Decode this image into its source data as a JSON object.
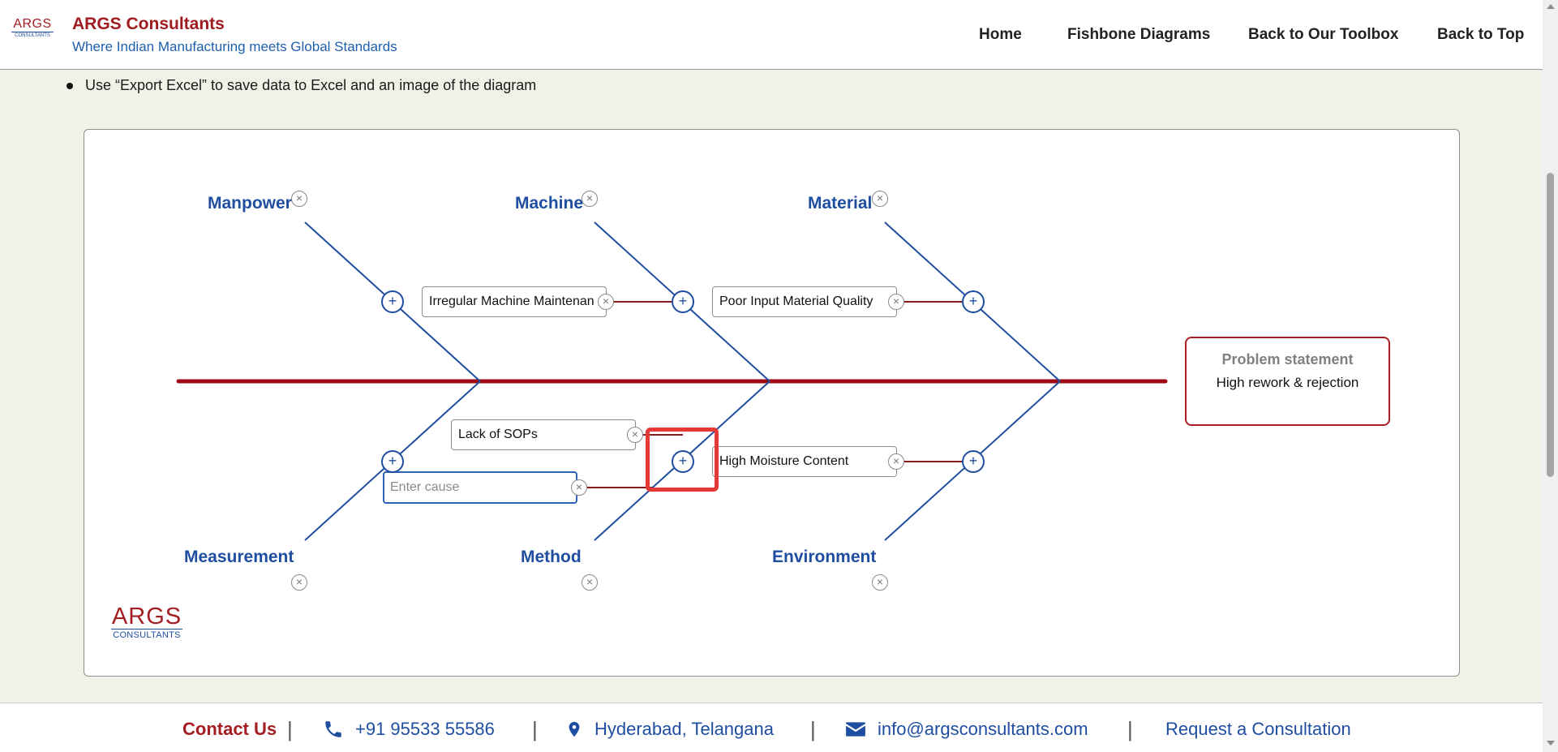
{
  "header": {
    "logo_text": "ARGS",
    "logo_sub": "CONSULTANTS",
    "title": "ARGS Consultants",
    "subtitle": "Where Indian Manufacturing meets Global Standards",
    "nav": [
      "Home",
      "Fishbone Diagrams",
      "Back to Our Toolbox",
      "Back to Top"
    ]
  },
  "instructions": {
    "bullet": "Use “Export Excel” to save data to Excel and an image of the diagram"
  },
  "diagram": {
    "categories": {
      "manpower": "Manpower",
      "machine": "Machine",
      "material": "Material",
      "measurement": "Measurement",
      "method": "Method",
      "environment": "Environment"
    },
    "causes": {
      "machine_1": "Irregular Machine Maintenan",
      "material_1": "Poor Input Material Quality",
      "method_1": "Lack of SOPs",
      "environment_1": "High Moisture Content"
    },
    "new_cause_placeholder": "Enter cause",
    "problem": {
      "title": "Problem statement",
      "value": "High rework & rejection"
    },
    "watermark": {
      "logo_text": "ARGS",
      "logo_sub": "CONSULTANTS"
    },
    "icons": {
      "add": "+",
      "remove": "×"
    },
    "colors": {
      "spine": "#9e0a12",
      "bone": "#1f4ea1",
      "connector": "#8b1a1f",
      "highlight": "#e53935"
    }
  },
  "footer": {
    "contact_label": "Contact Us",
    "separator": "|",
    "phone": "+91 95533 55586",
    "location": "Hyderabad, Telangana",
    "email": "info@argsconsultants.com",
    "cta": "Request a Consultation"
  }
}
